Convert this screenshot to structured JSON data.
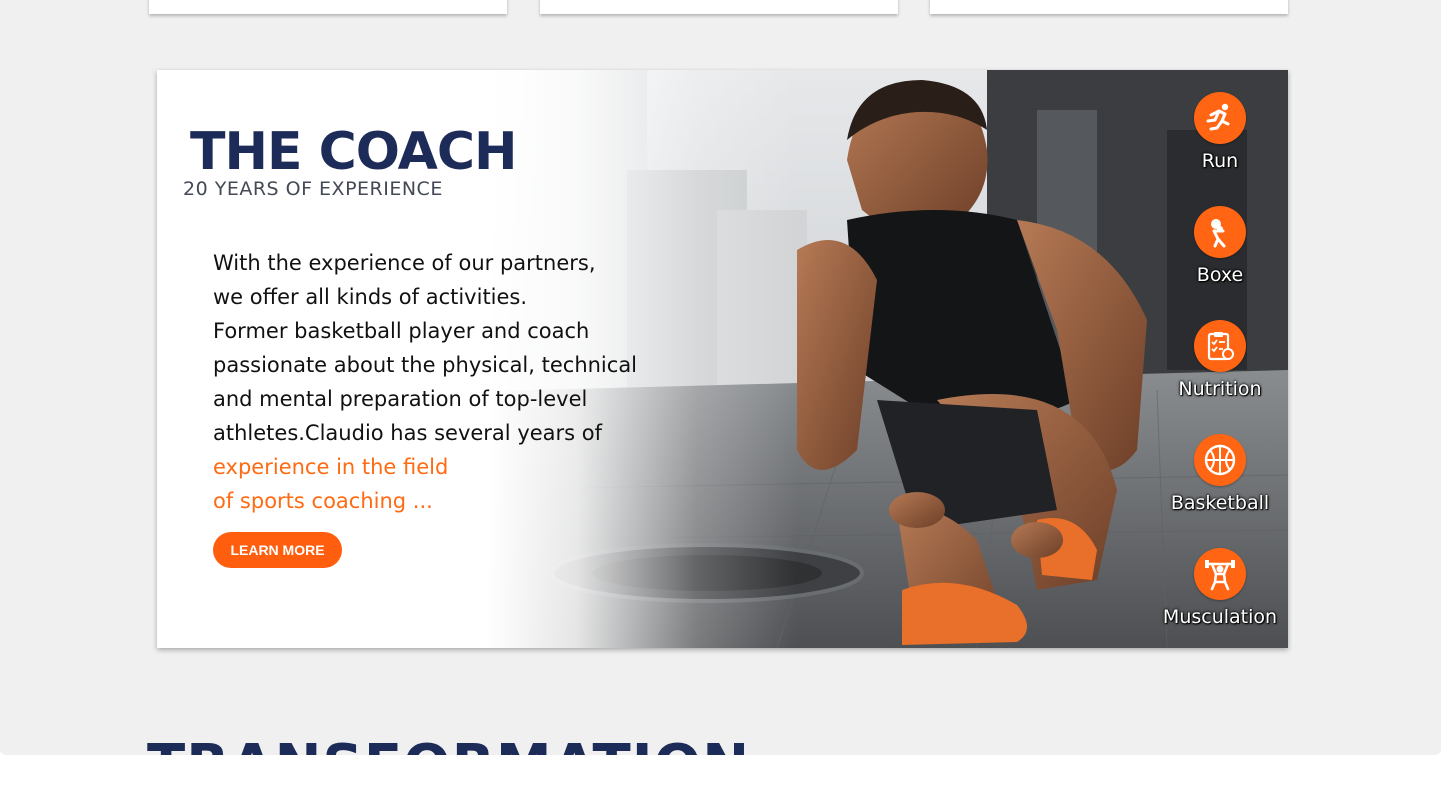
{
  "hero": {
    "title": "THE COACH",
    "subtitle": "20 YEARS OF EXPERIENCE",
    "description_lines": [
      "With the experience of our partners,",
      "we offer all kinds of activities.",
      "Former basketball player and coach",
      "passionate about the physical, technical",
      "and mental preparation of top-level",
      "athletes.Claudio has several years of"
    ],
    "highlight_lines": [
      "experience in the field",
      "of sports coaching ..."
    ],
    "button_label": "LEARN MORE"
  },
  "activities": [
    {
      "label": "Run",
      "icon": "running-icon"
    },
    {
      "label": "Boxe",
      "icon": "boxing-icon"
    },
    {
      "label": "Nutrition",
      "icon": "nutrition-clipboard-icon"
    },
    {
      "label": "Basketball",
      "icon": "basketball-icon"
    },
    {
      "label": "Musculation",
      "icon": "weightlifting-icon"
    }
  ],
  "section": {
    "title": "TRANSFORMATION"
  },
  "colors": {
    "navy": "#1c2b57",
    "orange": "#ff6512",
    "background": "#f0f0f0"
  }
}
